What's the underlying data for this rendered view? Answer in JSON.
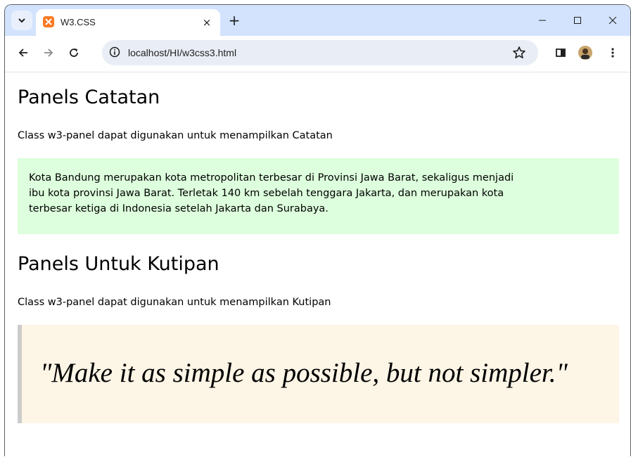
{
  "browser": {
    "tab_title": "W3.CSS",
    "tab_close": "×",
    "new_tab": "+",
    "url": "localhost/HI/w3css3.html",
    "icons": [
      "tab-list-icon",
      "xampp-favicon-icon",
      "back-icon",
      "forward-icon",
      "reload-icon",
      "site-info-icon",
      "bookmark-star-icon",
      "side-panel-icon",
      "profile-avatar-icon",
      "more-menu-icon",
      "minimize-icon",
      "maximize-icon",
      "close-window-icon"
    ]
  },
  "page": {
    "section1": {
      "heading": "Panels Catatan",
      "description": "Class w3-panel dapat digunakan untuk menampilkan Catatan",
      "note_lines": [
        "Kota Bandung merupakan kota metropolitan terbesar di Provinsi Jawa Barat, sekaligus menjadi",
        "ibu kota provinsi Jawa Barat. Terletak 140 km sebelah tenggara Jakarta, dan merupakan kota",
        "terbesar ketiga di Indonesia setelah Jakarta dan Surabaya."
      ],
      "note_color": "#ddffdd"
    },
    "section2": {
      "heading": "Panels Untuk Kutipan",
      "description": "Class w3-panel dapat digunakan untuk menampilkan Kutipan",
      "quote": "\"Make it as simple as possible, but not simpler.\"",
      "quote_bg": "#fdf5e6",
      "quote_border": "#cccccc"
    }
  }
}
